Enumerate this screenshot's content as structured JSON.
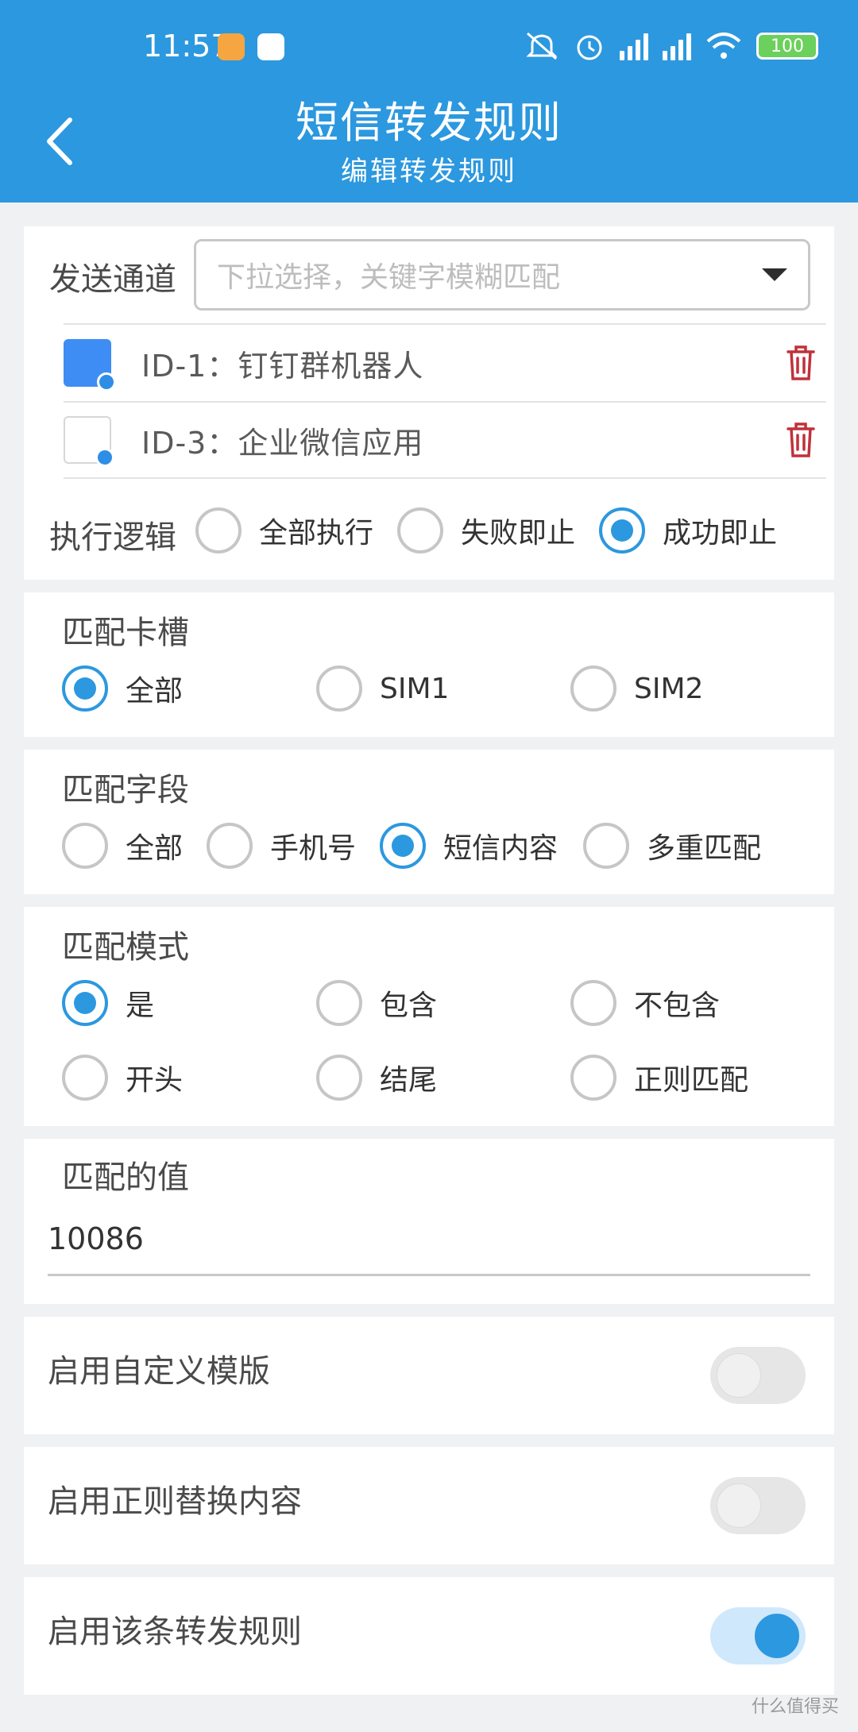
{
  "status": {
    "time": "11:57",
    "battery": "100"
  },
  "header": {
    "title": "短信转发规则",
    "subtitle": "编辑转发规则"
  },
  "channel": {
    "label": "发送通道",
    "placeholder": "下拉选择，关键字模糊匹配",
    "items": [
      {
        "text": "ID-1：钉钉群机器人",
        "icon": "dingtalk-icon"
      },
      {
        "text": "ID-3：企业微信应用",
        "icon": "wecom-icon"
      }
    ]
  },
  "exec_logic": {
    "label": "执行逻辑",
    "options": [
      "全部执行",
      "失败即止",
      "成功即止"
    ],
    "selected": "成功即止"
  },
  "sim_slot": {
    "title": "匹配卡槽",
    "options": [
      "全部",
      "SIM1",
      "SIM2"
    ],
    "selected": "全部"
  },
  "match_field": {
    "title": "匹配字段",
    "options": [
      "全部",
      "手机号",
      "短信内容",
      "多重匹配"
    ],
    "selected": "短信内容"
  },
  "match_mode": {
    "title": "匹配模式",
    "options": [
      "是",
      "包含",
      "不包含",
      "开头",
      "结尾",
      "正则匹配"
    ],
    "selected": "是"
  },
  "match_value": {
    "label": "匹配的值",
    "value": "10086"
  },
  "switches": [
    {
      "label": "启用自定义模版",
      "on": false
    },
    {
      "label": "启用正则替换内容",
      "on": false
    },
    {
      "label": "启用该条转发规则",
      "on": true
    }
  ],
  "watermark": "什么值得买",
  "colors": {
    "primary": "#2c98df",
    "danger": "#c0313a"
  }
}
